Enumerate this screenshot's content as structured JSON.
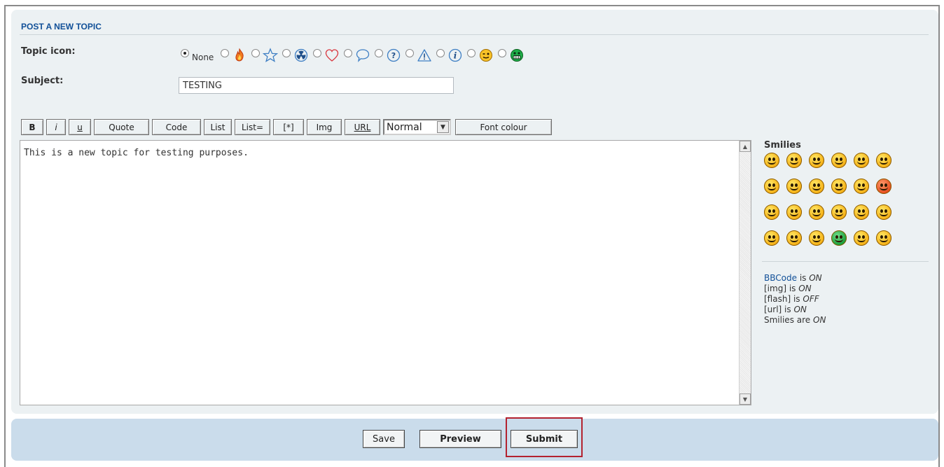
{
  "panel": {
    "title": "POST A NEW TOPIC",
    "topic_icon_label": "Topic icon:",
    "subject_label": "Subject:",
    "subject_value": "TESTING",
    "none_label": "None",
    "topic_icons": [
      "none",
      "fire-icon",
      "star-icon",
      "radioactive-icon",
      "heart-icon",
      "speech-bubble-icon",
      "question-icon",
      "warning-icon",
      "info-icon",
      "smiley-wink-icon",
      "smiley-grin-icon"
    ],
    "selected_topic_icon": "none"
  },
  "toolbar": {
    "bold": "B",
    "italic": "i",
    "underline": "u",
    "quote": "Quote",
    "code": "Code",
    "list": "List",
    "list_eq": "List=",
    "star": "[*]",
    "img": "Img",
    "url": "URL",
    "font_size": "Normal",
    "font_colour": "Font colour"
  },
  "editor": {
    "text": "This is a new topic for testing purposes."
  },
  "smilies": {
    "title": "Smilies",
    "count": 24
  },
  "bbinfo": {
    "bbcode_label": "BBCode",
    "bbcode_state": "ON",
    "img_label": "[img] is",
    "img_state": "ON",
    "flash_label": "[flash] is",
    "flash_state": "OFF",
    "url_label": "[url] is",
    "url_state": "ON",
    "smilies_label": "Smilies are",
    "smilies_state": "ON",
    "is": "is"
  },
  "actions": {
    "save": "Save",
    "preview": "Preview",
    "submit": "Submit"
  },
  "colors": {
    "panel_bg": "#ecf1f3",
    "bottom_bar_bg": "#cadceb",
    "title_blue": "#115098",
    "highlight_red": "#b3222f"
  }
}
